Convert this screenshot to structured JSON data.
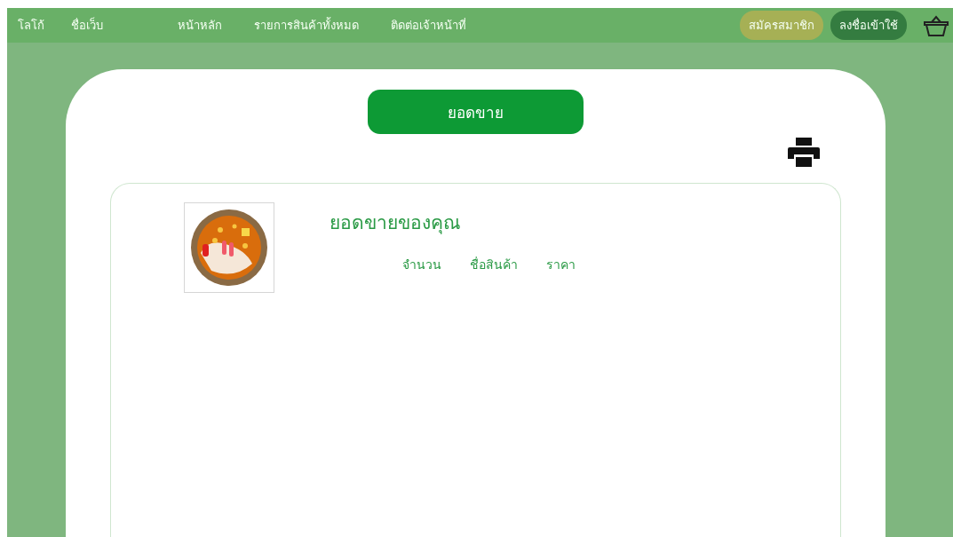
{
  "nav": {
    "logo": "โลโก้",
    "site_name": "ชื่อเว็บ",
    "links": [
      "หน้าหลัก",
      "รายการสินค้าทั้งหมด",
      "ติดต่อเจ้าหน้าที่"
    ],
    "signup": "สมัครสมาชิก",
    "login": "ลงชื่อเข้าใช้"
  },
  "page": {
    "heading_button": "ยอดขาย"
  },
  "sales": {
    "title": "ยอดขายของคุณ",
    "columns": [
      "จำนวน",
      "ชื่อสินค้า",
      "ราคา"
    ]
  }
}
